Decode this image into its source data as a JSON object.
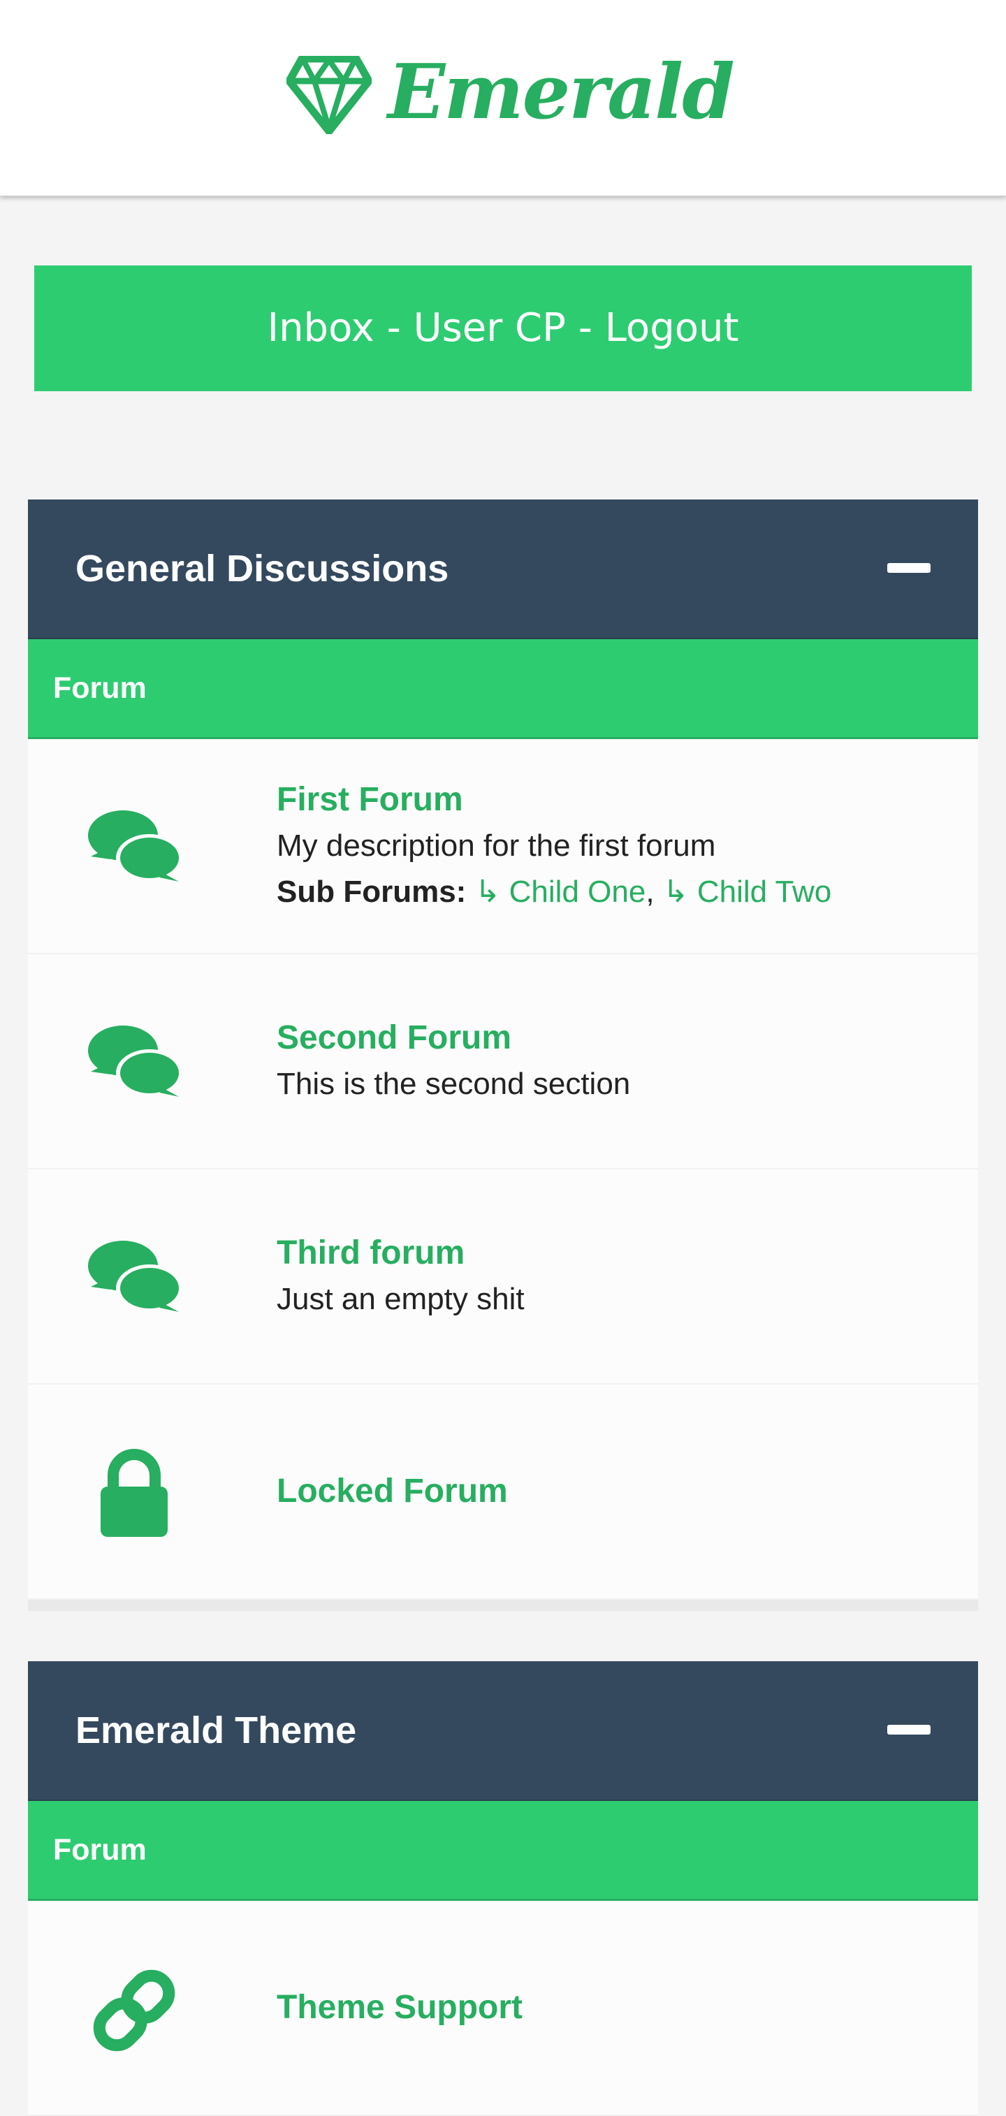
{
  "brand": {
    "name": "Emerald",
    "icon": "diamond-icon",
    "color": "#27ae60"
  },
  "topnav": {
    "text": "Inbox - User CP - Logout",
    "color": "#2ecc71"
  },
  "colors": {
    "category_header": "#34495e",
    "column_header": "#2ecc71",
    "accent": "#27ae60"
  },
  "categories": [
    {
      "title": "General Discussions",
      "column_label": "Forum",
      "forums": [
        {
          "icon": "comments-icon",
          "name": "First Forum",
          "description": "My description for the first forum",
          "subforums_label": "Sub Forums:",
          "subforums": [
            "↳ Child One",
            "↳ Child Two"
          ]
        },
        {
          "icon": "comments-icon",
          "name": "Second Forum",
          "description": "This is the second section"
        },
        {
          "icon": "comments-icon",
          "name": "Third forum",
          "description": "Just an empty shit"
        },
        {
          "icon": "lock-icon",
          "name": "Locked Forum"
        }
      ]
    },
    {
      "title": "Emerald Theme",
      "column_label": "Forum",
      "forums": [
        {
          "icon": "link-icon",
          "name": "Theme Support"
        }
      ]
    }
  ]
}
